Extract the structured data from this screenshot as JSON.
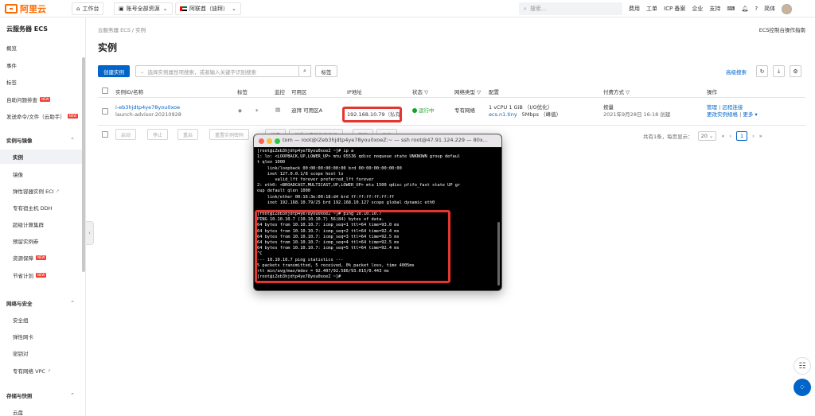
{
  "topbar": {
    "logo_text": "阿里云",
    "workbench": "工作台",
    "resource_scope": "账号全部资源",
    "region": "阿联酋（迪拜）",
    "search_placeholder": "搜索...",
    "links": [
      "费用",
      "工单",
      "ICP 备案",
      "企业",
      "支持"
    ],
    "lang": "简体"
  },
  "sidebar": {
    "title": "云服务器 ECS",
    "items": [
      {
        "label": "概览"
      },
      {
        "label": "事件"
      },
      {
        "label": "标签"
      },
      {
        "label": "自助问题排查",
        "badge": "NEW"
      },
      {
        "label": "发送命令/文件（云助手）",
        "badge": "NEW"
      },
      {
        "label": "实例与镜像",
        "group": true
      },
      {
        "label": "实例",
        "active": true
      },
      {
        "label": "镜像"
      },
      {
        "label": "弹性容器实例 ECI"
      },
      {
        "label": "专有宿主机 DDH"
      },
      {
        "label": "超级计算集群"
      },
      {
        "label": "预留实例券"
      },
      {
        "label": "资源保障",
        "badge": "NEW"
      },
      {
        "label": "节省计划",
        "badge": "NEW"
      },
      {
        "label": "网络与安全",
        "group": true
      },
      {
        "label": "安全组"
      },
      {
        "label": "弹性网卡"
      },
      {
        "label": "密钥对"
      },
      {
        "label": "专有网络 VPC"
      },
      {
        "label": "存储与快照",
        "group": true
      },
      {
        "label": "云盘"
      }
    ]
  },
  "main": {
    "breadcrumb": "云服务器 ECS / 实例",
    "help_link": "ECS控制台操作指南",
    "title": "实例",
    "create_button": "创建实例",
    "filter_placeholder": "选择实例属性项搜索，或者输入关键字识别搜索",
    "tag_button": "标签",
    "advanced_search": "高级搜索",
    "columns": [
      "实例ID/名称",
      "标签",
      "监控",
      "可用区",
      "IP地址",
      "状态",
      "网络类型",
      "配置",
      "付费方式",
      "操作"
    ],
    "row": {
      "instance_id": "i-eb3hjdtp4ye78you0xoe",
      "instance_name": "launch-advisor-20210928",
      "zone": "迪拜 可用区A",
      "ip": "192.168.10.79",
      "ip_type": "（私有）",
      "status": "运行中",
      "network": "专有网络",
      "config_line1": "1 vCPU 1 GiB （I/O优化）",
      "config_type": "ecs.n1.tiny",
      "bandwidth": "5Mbps （峰值）",
      "pay_type": "按量",
      "created": "2021年9月28日 16:18 创建",
      "op_manage": "管理",
      "op_remote": "远程连接",
      "op_change": "更改实例规格",
      "op_more": "更多"
    },
    "bulk_actions": [
      "启动",
      "停止",
      "重启",
      "重置实例密码",
      "续费",
      "按量付费转包年包月",
      "释放",
      "更多"
    ],
    "pager": {
      "summary": "共有1条，每页显示：",
      "page_size": "20",
      "current": "1"
    }
  },
  "terminal": {
    "title": "tom — root@iZeb3hjdtp4ye78you0xoeZ:~ — ssh root@47.91.124.229 — 80x...",
    "lines": [
      "[root@iZeb3hjdtp4ye78you0xoeZ ~]# ip a",
      "1: lo: <LOOPBACK,UP,LOWER_UP> mtu 65536 qdisc noqueue state UNKNOWN group defaul",
      "t qlen 1000",
      "    link/loopback 00:00:00:00:00:00 brd 00:00:00:00:00:00",
      "    inet 127.0.0.1/8 scope host lo",
      "       valid_lft forever preferred_lft forever",
      "2: eth0: <BROADCAST,MULTICAST,UP,LOWER_UP> mtu 1500 qdisc pfifo_fast state UP gr",
      "oup default qlen 1000",
      "    link/ether 00:16:3e:00:18:d4 brd ff:ff:ff:ff:ff:ff",
      "    inet 192.168.10.79/25 brd 192.168.10.127 scope global dynamic eth0",
      "",
      "[root@iZeb3hjdtp4ye78you0xoeZ ~]# ping 10.10.10.7",
      "PING 10.10.10.7 (10.10.10.7) 56(84) bytes of data.",
      "64 bytes from 10.10.10.7: icmp_seq=1 ttl=64 time=93.0 ms",
      "64 bytes from 10.10.10.7: icmp_seq=2 ttl=64 time=92.4 ms",
      "64 bytes from 10.10.10.7: icmp_seq=3 ttl=64 time=92.5 ms",
      "64 bytes from 10.10.10.7: icmp_seq=4 ttl=64 time=92.5 ms",
      "64 bytes from 10.10.10.7: icmp_seq=5 ttl=64 time=92.4 ms",
      "^C",
      "--- 10.10.10.7 ping statistics ---",
      "5 packets transmitted, 5 received, 0% packet loss, time 4005ms",
      "rtt min/avg/max/mdev = 92.407/92.586/93.015/0.443 ms",
      "[root@iZeb3hjdtp4ye78you0xoeZ ~]# "
    ]
  },
  "colors": {
    "brand": "#ff6a00",
    "primary": "#0064c8",
    "highlight": "#e4362f",
    "running": "#1a9f2b"
  }
}
